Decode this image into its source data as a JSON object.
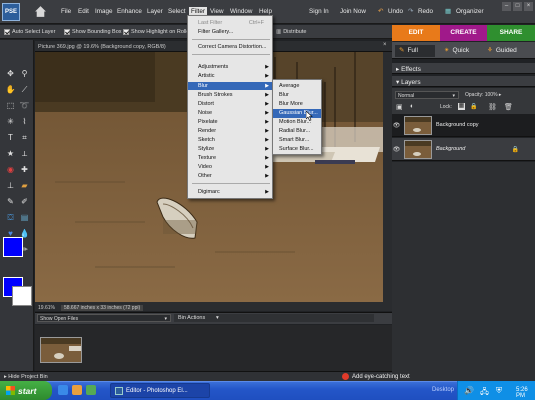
{
  "app": {
    "logo": "PSE"
  },
  "menubar": {
    "items": [
      "File",
      "Edit",
      "Image",
      "Enhance",
      "Layer",
      "Select",
      "Filter",
      "View",
      "Window",
      "Help"
    ],
    "right": {
      "sign_in": "Sign In",
      "join_now": "Join Now",
      "undo": "Undo",
      "redo": "Redo",
      "organizer": "Organizer"
    }
  },
  "options": {
    "auto_select": "Auto Select Layer",
    "bounding_box": "Show Bounding Box",
    "highlight": "Show Highlight on Rollo",
    "distribute": "Distribute"
  },
  "modes": {
    "edit": "EDIT",
    "create": "CREATE",
    "share": "SHARE",
    "edit_color": "#e87a1a",
    "create_color": "#a0198a",
    "share_color": "#2f8f2f"
  },
  "subtabs": {
    "full": "Full",
    "quick": "Quick",
    "guided": "Guided"
  },
  "document": {
    "title": "Picture 369.jpg @ 19.6% (Background copy, RGB/8)",
    "zoom": "19.61%",
    "dimensions": "58.667 inches x 33 inches (72 ppi)"
  },
  "filter_menu": {
    "last_filter": "Last Filter",
    "last_filter_shortcut": "Ctrl+F",
    "gallery": "Filter Gallery...",
    "camera": "Correct Camera Distortion...",
    "items": [
      "Adjustments",
      "Artistic",
      "Blur",
      "Brush Strokes",
      "Distort",
      "Noise",
      "Pixelate",
      "Render",
      "Sketch",
      "Stylize",
      "Texture",
      "Video",
      "Other"
    ],
    "digimarc": "Digimarc"
  },
  "blur_menu": {
    "items": [
      "Average",
      "Blur",
      "Blur More",
      "Gaussian Blur...",
      "Motion Blur...",
      "Radial Blur...",
      "Smart Blur...",
      "Surface Blur..."
    ]
  },
  "panels": {
    "effects": "Effects",
    "layers": "Layers",
    "blend_mode": "Normal",
    "opacity_label": "Opacity:",
    "opacity_value": "100%",
    "lock_label": "Lock:"
  },
  "layers": [
    {
      "name": "Background copy"
    },
    {
      "name": "Background"
    }
  ],
  "bin": {
    "dropdown": "Show Open Files",
    "actions": "Bin Actions",
    "hide": "Hide Project Bin"
  },
  "tip": "Add eye-catching text",
  "taskbar": {
    "start": "start",
    "task": "Editor - Photoshop El...",
    "desktop": "Desktop",
    "clock": "5:26 PM"
  },
  "colors": {
    "foreground": "#0000ff",
    "background": "#ffffff"
  }
}
